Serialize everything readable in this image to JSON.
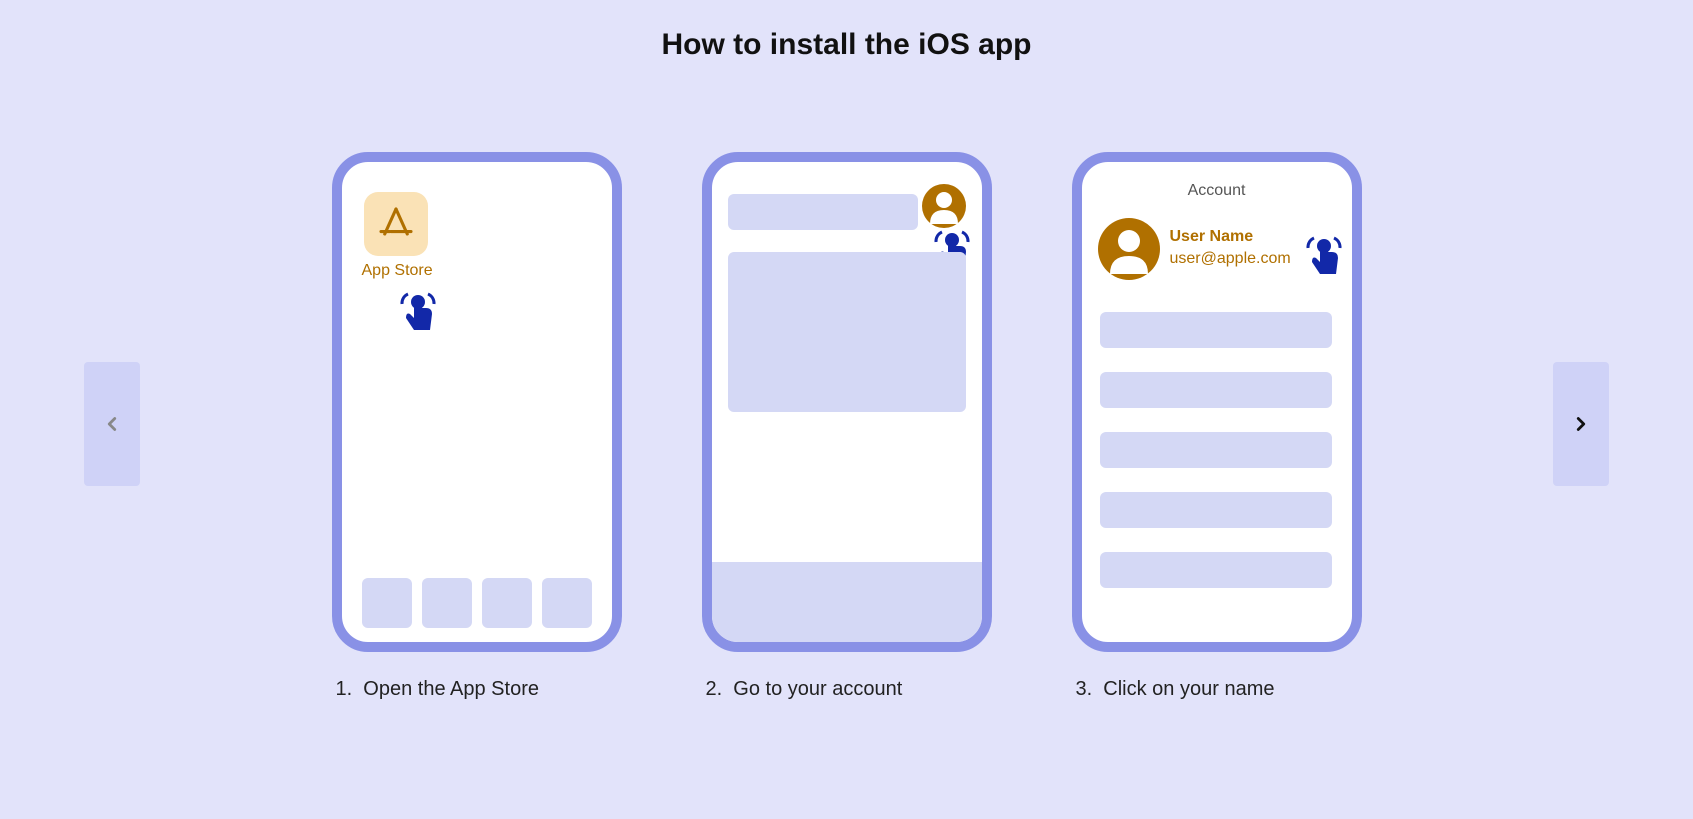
{
  "title": "How to install the iOS app",
  "steps": [
    {
      "caption": "Open the App Store",
      "app_label": "App Store"
    },
    {
      "caption": "Go to your account"
    },
    {
      "caption": "Click on your name",
      "account_title": "Account",
      "user_name": "User Name",
      "user_email": "user@apple.com"
    }
  ]
}
